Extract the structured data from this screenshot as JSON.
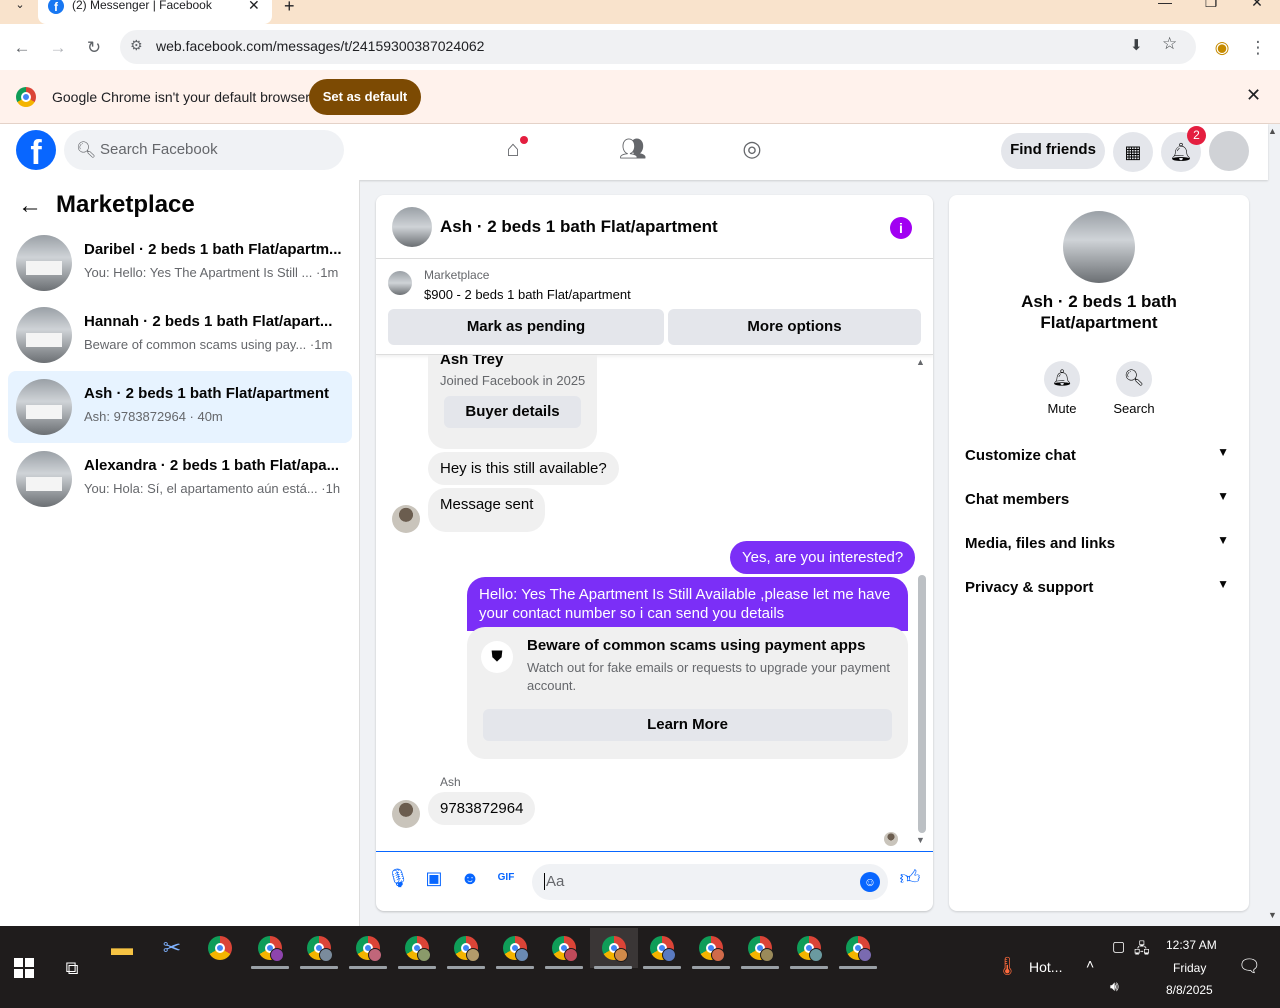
{
  "browser": {
    "tab_title": "(2) Messenger | Facebook",
    "url": "web.facebook.com/messages/t/24159300387024062",
    "infobar_text": "Google Chrome isn't your default browser",
    "set_default_label": "Set as default"
  },
  "fb_header": {
    "search_placeholder": "Search Facebook",
    "find_friends_label": "Find friends",
    "notification_count": "2"
  },
  "sidebar": {
    "title": "Marketplace",
    "conversations": [
      {
        "name": "Daribel · 2 beds 1 bath Flat/apartm...",
        "snippet": "You: Hello: Yes The Apartment Is Still ... ·1m",
        "active": false
      },
      {
        "name": "Hannah · 2 beds 1 bath Flat/apart...",
        "snippet": "Beware of common scams using pay... ·1m",
        "active": false
      },
      {
        "name": "Ash · 2 beds 1 bath Flat/apartment",
        "snippet": "Ash: 9783872964 · 40m",
        "active": true
      },
      {
        "name": "Alexandra · 2 beds 1 bath Flat/apa...",
        "snippet": "You: Hola: Sí, el apartamento aún está... ·1h",
        "active": false
      }
    ]
  },
  "chat": {
    "title": "Ash · 2 beds 1 bath Flat/apartment",
    "listing_category": "Marketplace",
    "listing_price_title": "$900 - 2 beds 1 bath Flat/apartment",
    "mark_pending_label": "Mark as pending",
    "more_options_label": "More options",
    "buyer_name": "Ash Trey",
    "buyer_joined": "Joined Facebook in 2025",
    "buyer_details_label": "Buyer details",
    "msg_in_1": "Hey is this still available?",
    "msg_in_2": "Message sent",
    "msg_out_1": "Yes, are you interested?",
    "msg_out_2": "Hello: Yes The Apartment Is Still Available ,please let me have your contact number so i can send you details",
    "warning_title": "Beware of common scams using payment apps",
    "warning_body": "Watch out for fake emails or requests to upgrade your payment account.",
    "learn_more_label": "Learn More",
    "sender_label": "Ash",
    "msg_in_3": "9783872964",
    "composer_placeholder": "Aa"
  },
  "info_panel": {
    "name": "Ash · 2 beds 1 bath Flat/apartment",
    "mute_label": "Mute",
    "search_label": "Search",
    "sections": [
      "Customize chat",
      "Chat members",
      "Media, files and links",
      "Privacy & support"
    ]
  },
  "taskbar": {
    "weather_text": "Hot...",
    "time": "12:37 AM",
    "day": "Friday",
    "date": "8/8/2025"
  },
  "colors": {
    "fb_blue": "#0866ff",
    "outgoing_bubble": "#7b2ff7",
    "set_default_button": "#7c4a03",
    "notification_red": "#e41e3f"
  }
}
